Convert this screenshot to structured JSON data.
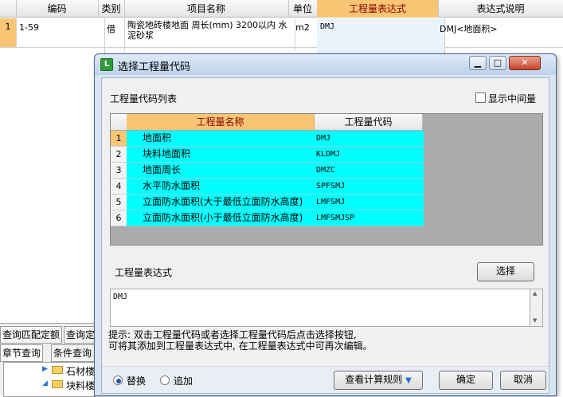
{
  "bg_table": {
    "headers": [
      "编码",
      "类别",
      "项目名称",
      "单位",
      "工程量表达式",
      "表达式说明"
    ],
    "row": {
      "index": "1",
      "code": "1-59",
      "type": "借",
      "name": "陶瓷地砖楼地面 周长(mm) 3200以内 水泥砂浆",
      "unit": "m2",
      "expression": "DMJ",
      "explanation": "DMJ<地面积>"
    }
  },
  "bg_left": {
    "tab_match": "查询匹配定额",
    "tab_query_trunc": "查询定额",
    "tab_chapter": "章节查询",
    "tab_condition": "条件查询",
    "tree_item_1": "石材楼",
    "tree_item_2": "块料楼"
  },
  "dialog": {
    "title": "选择工程量代码",
    "list_label": "工程量代码列表",
    "show_intermediate": "显示中间量",
    "columns": [
      "工程量名称",
      "工程量代码"
    ],
    "rows": [
      {
        "no": "1",
        "name": "地面积",
        "code": "DMJ"
      },
      {
        "no": "2",
        "name": "块料地面积",
        "code": "KLDMJ"
      },
      {
        "no": "3",
        "name": "地面周长",
        "code": "DMZC"
      },
      {
        "no": "4",
        "name": "水平防水面积",
        "code": "SPFSMJ"
      },
      {
        "no": "5",
        "name": "立面防水面积(大于最低立面防水高度)",
        "code": "LMFSMJ"
      },
      {
        "no": "6",
        "name": "立面防水面积(小于最低立面防水高度)",
        "code": "LMFSMJSP"
      }
    ],
    "expr_label": "工程量表达式",
    "select_button": "选择",
    "expr_value": "DMJ",
    "hint_line1": "提示: 双击工程量代码或者选择工程量代码后点击选择按钮,",
    "hint_line2": "可将其添加到工程量表达式中, 在工程量表达式中可再次编辑。",
    "radio_replace": "替换",
    "radio_append": "追加",
    "view_rules": "查看计算规则",
    "ok": "确定",
    "cancel": "取消"
  },
  "colors": {
    "row_highlight": "#00ffff",
    "header_orange": "#f7c574",
    "title_blue": "#bcd2ea"
  }
}
